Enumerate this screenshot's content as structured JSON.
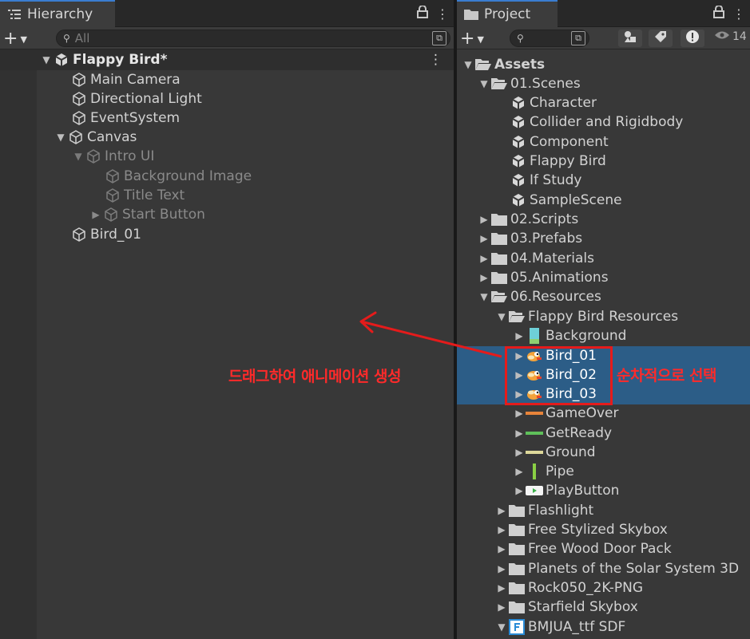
{
  "hierarchy": {
    "tab_title": "Hierarchy",
    "search_placeholder": "All",
    "scene_name": "Flappy Bird*",
    "items": [
      {
        "label": "Main Camera"
      },
      {
        "label": "Directional Light"
      },
      {
        "label": "EventSystem"
      },
      {
        "label": "Canvas"
      },
      {
        "label": "Intro UI"
      },
      {
        "label": "Background Image"
      },
      {
        "label": "Title Text"
      },
      {
        "label": "Start Button"
      },
      {
        "label": "Bird_01"
      }
    ]
  },
  "project": {
    "tab_title": "Project",
    "hidden_count": "14",
    "root": "Assets",
    "items": [
      {
        "label": "01.Scenes"
      },
      {
        "label": "Character"
      },
      {
        "label": "Collider and Rigidbody"
      },
      {
        "label": "Component"
      },
      {
        "label": "Flappy Bird"
      },
      {
        "label": "If Study"
      },
      {
        "label": "SampleScene"
      },
      {
        "label": "02.Scripts"
      },
      {
        "label": "03.Prefabs"
      },
      {
        "label": "04.Materials"
      },
      {
        "label": "05.Animations"
      },
      {
        "label": "06.Resources"
      },
      {
        "label": "Flappy Bird Resources"
      },
      {
        "label": "Background"
      },
      {
        "label": "Bird_01"
      },
      {
        "label": "Bird_02"
      },
      {
        "label": "Bird_03"
      },
      {
        "label": "GameOver"
      },
      {
        "label": "GetReady"
      },
      {
        "label": "Ground"
      },
      {
        "label": "Pipe"
      },
      {
        "label": "PlayButton"
      },
      {
        "label": "Flashlight"
      },
      {
        "label": "Free Stylized Skybox"
      },
      {
        "label": "Free Wood Door Pack"
      },
      {
        "label": "Planets of the Solar System 3D"
      },
      {
        "label": "Rock050_2K-PNG"
      },
      {
        "label": "Starfield Skybox"
      },
      {
        "label": "BMJUA_ttf SDF"
      }
    ]
  },
  "annotations": {
    "drag_text": "드래그하여 애니메이션 생성",
    "select_text": "순차적으로 선택",
    "color": "#e51b1b"
  }
}
